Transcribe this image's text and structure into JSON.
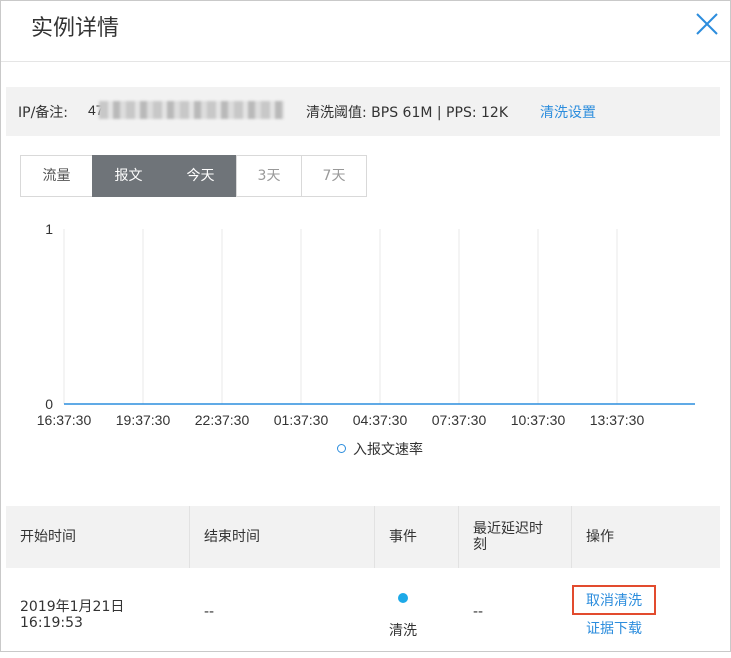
{
  "dialog": {
    "title": "实例详情",
    "close_icon": "close-icon"
  },
  "info": {
    "ip_label": "IP/备注: ",
    "ip_value_visible": "47",
    "threshold": "清洗阈值: BPS 61M | PPS: 12K",
    "settings_link": "清洗设置"
  },
  "tabs": [
    {
      "label": "流量",
      "active": false
    },
    {
      "label": "报文",
      "active": true
    },
    {
      "label": "今天",
      "active": true
    },
    {
      "label": "3天",
      "active": false
    },
    {
      "label": "7天",
      "active": false
    }
  ],
  "chart_data": {
    "type": "line",
    "x": [
      "16:37:30",
      "19:37:30",
      "22:37:30",
      "01:37:30",
      "04:37:30",
      "07:37:30",
      "10:37:30",
      "13:37:30"
    ],
    "series": [
      {
        "name": "入报文速率",
        "values": [
          0,
          0,
          0,
          0,
          0,
          0,
          0,
          0,
          0
        ]
      }
    ],
    "ylim": [
      0,
      1
    ],
    "yticks": [
      "0",
      "1"
    ],
    "grid": true,
    "legend": "bottom",
    "color": "#2c8ddd"
  },
  "table": {
    "headers": [
      "开始时间",
      "结束时间",
      "事件",
      "最近延迟时刻",
      "操作"
    ],
    "rows": [
      {
        "start_date": "2019年1月21日",
        "start_time": "16:19:53",
        "end": "--",
        "event": "清洗",
        "delay": "--",
        "ops": [
          "取消清洗",
          "证据下载"
        ]
      }
    ]
  },
  "colors": {
    "accent": "#2c8ddd",
    "tab_active": "#6f7479",
    "highlight": "#e24b2e",
    "event_dot": "#1da9e8"
  }
}
